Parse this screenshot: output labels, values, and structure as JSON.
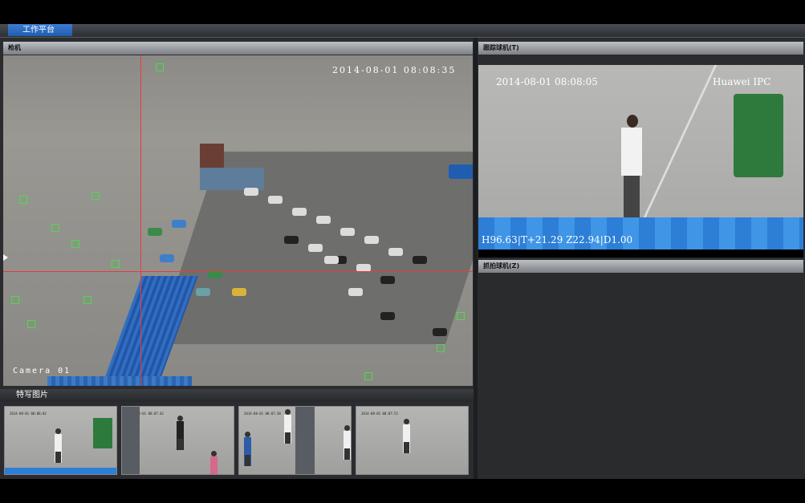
{
  "app": {
    "active_tab": "工作平台"
  },
  "panels": {
    "main_camera": {
      "title": "枪机",
      "timestamp": "2014-08-01 08:08:35",
      "camera_label": "Camera 01"
    },
    "tracking_camera": {
      "title": "跟踪球机(T)",
      "timestamp": "2014-08-01  08:08:05",
      "brand": "Huawei IPC",
      "ptz_readout": "H96.63|T+21.29  Z22.94|D1.00"
    },
    "capture_camera": {
      "title": "抓拍球机(Z)"
    },
    "closeups": {
      "title": "特写图片",
      "thumbnails": [
        {
          "timestamp": "2014-08-01 08:08:02"
        },
        {
          "timestamp": "2014-08-01 08:07:42"
        },
        {
          "timestamp": "2014-08-01 08:07:38"
        },
        {
          "timestamp": "2014-08-01 08:07:53"
        }
      ]
    }
  },
  "colors": {
    "crosshair": "#e83b3b",
    "track_box": "#3fe43f",
    "tab_active": "#2f6fc4"
  }
}
